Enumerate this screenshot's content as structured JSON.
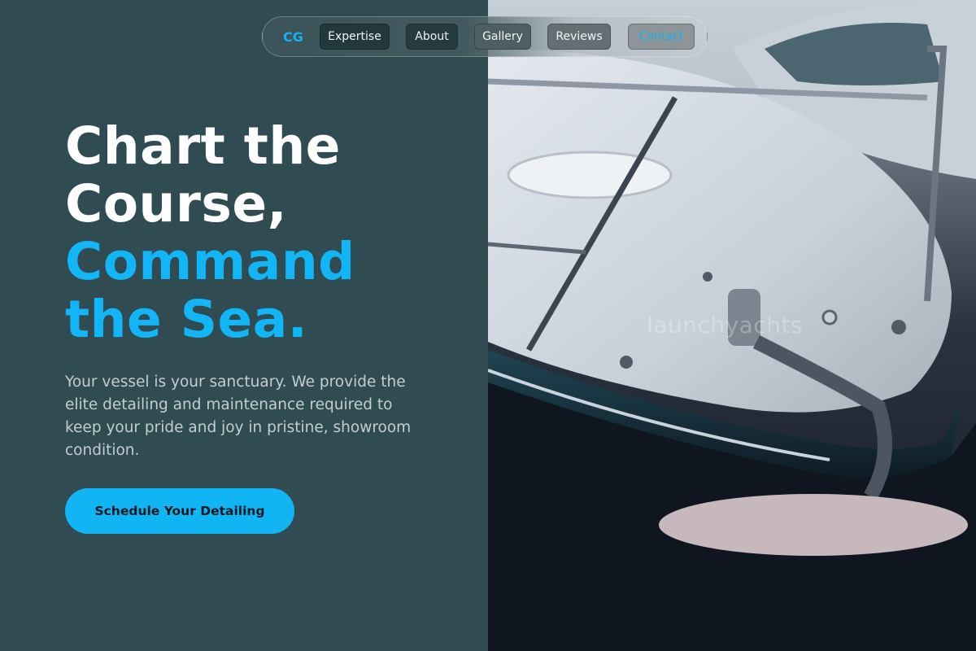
{
  "nav": {
    "logo": "CG",
    "items": [
      {
        "label": "Expertise"
      },
      {
        "label": "About"
      },
      {
        "label": "Gallery"
      },
      {
        "label": "Reviews"
      },
      {
        "label": "Contact"
      }
    ]
  },
  "hero": {
    "headline_line1": "Chart the",
    "headline_line2": "Course,",
    "headline_line3": "Command",
    "headline_line4": "the Sea.",
    "description": "Your vessel is your sanctuary. We provide the elite detailing and maintenance required to keep your pride and joy in pristine, showroom condition.",
    "cta_label": "Schedule Your Detailing"
  },
  "image": {
    "watermark": "launchyachts"
  },
  "colors": {
    "accent": "#12b5f5",
    "panel": "#304b51",
    "headline_white": "#ffffff"
  }
}
